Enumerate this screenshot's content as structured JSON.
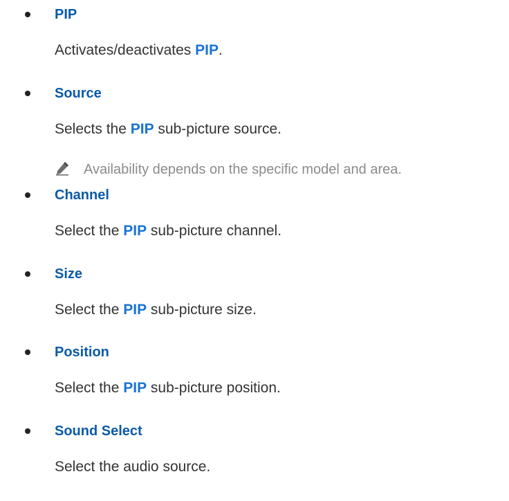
{
  "items": [
    {
      "title": "PIP",
      "desc_before": "Activates/deactivates ",
      "desc_hl": "PIP",
      "desc_after": "."
    },
    {
      "title": "Source",
      "desc_before": "Selects the ",
      "desc_hl": "PIP",
      "desc_after": " sub-picture source.",
      "note": "Availability depends on the specific model and area."
    },
    {
      "title": "Channel",
      "desc_before": "Select the ",
      "desc_hl": "PIP",
      "desc_after": " sub-picture channel."
    },
    {
      "title": "Size",
      "desc_before": "Select the ",
      "desc_hl": "PIP",
      "desc_after": " sub-picture size."
    },
    {
      "title": "Position",
      "desc_before": "Select the ",
      "desc_hl": "PIP",
      "desc_after": " sub-picture position."
    },
    {
      "title": "Sound Select",
      "desc": "Select the audio source."
    }
  ],
  "colors": {
    "title": "#0a5aa8",
    "highlight": "#1a73d4",
    "body_text": "#333333",
    "note_text": "#8a8a8a"
  },
  "icons": {
    "note": "pencil-note-icon",
    "bullet": "bullet-dot"
  }
}
